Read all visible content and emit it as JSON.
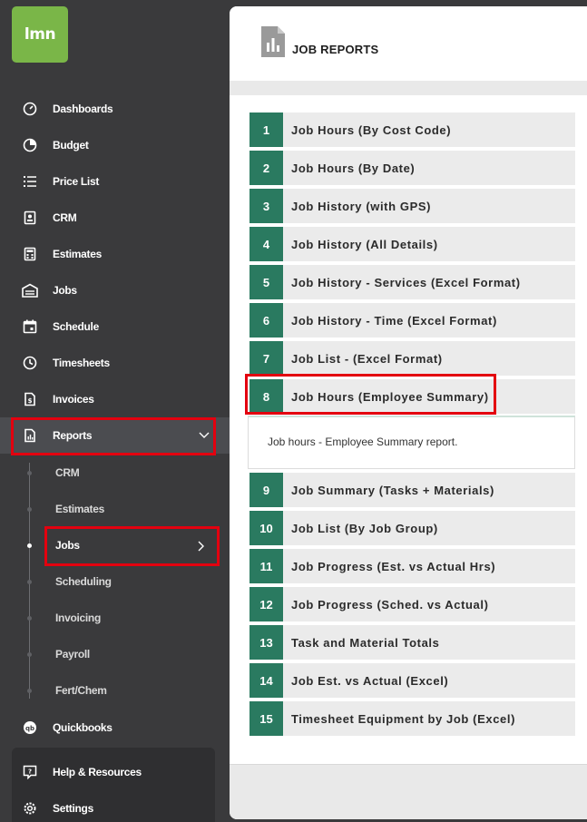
{
  "app": {
    "logo_text": "lmn",
    "brand_color": "#7ab648"
  },
  "sidebar": {
    "items": [
      {
        "label": "Dashboards",
        "icon": "gauge-icon"
      },
      {
        "label": "Budget",
        "icon": "pie-chart-icon"
      },
      {
        "label": "Price List",
        "icon": "list-icon"
      },
      {
        "label": "CRM",
        "icon": "contact-card-icon"
      },
      {
        "label": "Estimates",
        "icon": "calculator-icon"
      },
      {
        "label": "Jobs",
        "icon": "garage-icon"
      },
      {
        "label": "Schedule",
        "icon": "calendar-icon"
      },
      {
        "label": "Timesheets",
        "icon": "clock-icon"
      },
      {
        "label": "Invoices",
        "icon": "invoice-icon"
      },
      {
        "label": "Reports",
        "icon": "report-icon"
      }
    ],
    "reports_sub": [
      "CRM",
      "Estimates",
      "Jobs",
      "Scheduling",
      "Invoicing",
      "Payroll",
      "Fert/Chem"
    ],
    "quickbooks": "Quickbooks",
    "help": "Help & Resources",
    "settings": "Settings"
  },
  "main": {
    "title": "JOB REPORTS",
    "reports": [
      {
        "num": "1",
        "name": "Job Hours (By Cost Code)"
      },
      {
        "num": "2",
        "name": "Job Hours (By Date)"
      },
      {
        "num": "3",
        "name": "Job History (with GPS)"
      },
      {
        "num": "4",
        "name": "Job History (All Details)"
      },
      {
        "num": "5",
        "name": "Job History - Services (Excel Format)"
      },
      {
        "num": "6",
        "name": "Job History - Time (Excel Format)"
      },
      {
        "num": "7",
        "name": "Job List - (Excel Format)"
      },
      {
        "num": "8",
        "name": "Job Hours (Employee Summary)"
      },
      {
        "num": "9",
        "name": "Job Summary (Tasks + Materials)"
      },
      {
        "num": "10",
        "name": "Job List (By Job Group)"
      },
      {
        "num": "11",
        "name": "Job Progress (Est. vs Actual Hrs)"
      },
      {
        "num": "12",
        "name": "Job Progress (Sched. vs Actual)"
      },
      {
        "num": "13",
        "name": "Task and Material Totals"
      },
      {
        "num": "14",
        "name": "Job Est. vs Actual (Excel)"
      },
      {
        "num": "15",
        "name": "Timesheet Equipment by Job (Excel)"
      }
    ],
    "expanded_description": "Job hours - Employee Summary report.",
    "accent_color": "#2a7a60",
    "highlight_color": "#e3000f"
  }
}
